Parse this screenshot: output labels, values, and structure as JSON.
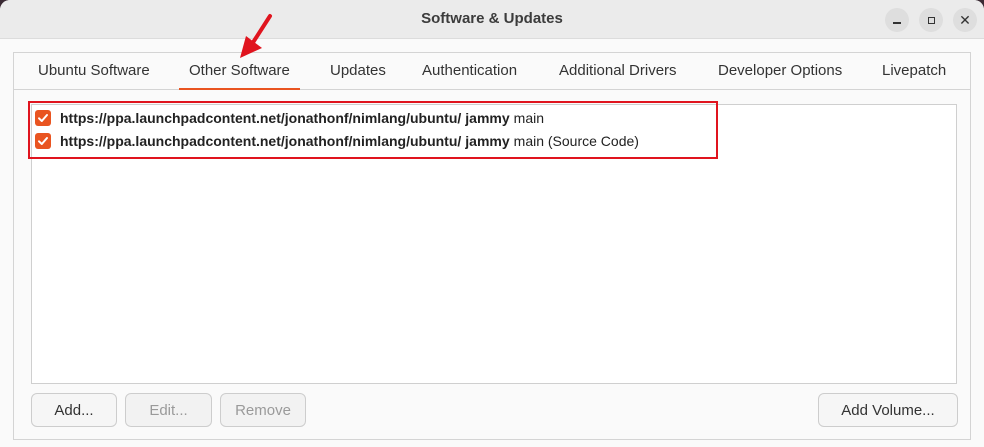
{
  "window": {
    "title": "Software & Updates"
  },
  "tabs": [
    {
      "label": "Ubuntu Software"
    },
    {
      "label": "Other Software"
    },
    {
      "label": "Updates"
    },
    {
      "label": "Authentication"
    },
    {
      "label": "Additional Drivers"
    },
    {
      "label": "Developer Options"
    },
    {
      "label": "Livepatch"
    }
  ],
  "active_tab": "Other Software",
  "sources": [
    {
      "checked": true,
      "url": "https://ppa.launchpadcontent.net/jonathonf/nimlang/ubuntu/",
      "suite": "jammy",
      "component": "main"
    },
    {
      "checked": true,
      "url": "https://ppa.launchpadcontent.net/jonathonf/nimlang/ubuntu/",
      "suite": "jammy",
      "component": "main (Source Code)"
    }
  ],
  "buttons": {
    "add": "Add...",
    "edit": "Edit...",
    "remove": "Remove",
    "add_volume": "Add Volume..."
  },
  "colors": {
    "accent": "#e95420",
    "annotation": "#e0141e"
  }
}
